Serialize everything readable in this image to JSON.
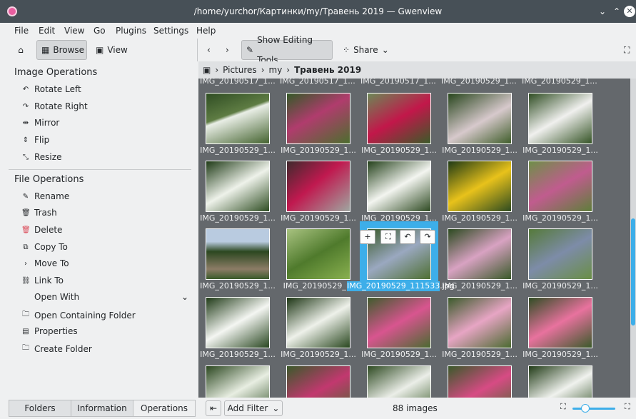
{
  "window": {
    "title": "/home/yurchor/Картинки/my/Травень 2019 — Gwenview"
  },
  "menu": [
    "File",
    "Edit",
    "View",
    "Go",
    "Plugins",
    "Settings",
    "Help"
  ],
  "toolbar": {
    "browse": "Browse",
    "view": "View",
    "show_editing_tools": "Show Editing Tools",
    "share": "Share"
  },
  "sidebar": {
    "image_ops_title": "Image Operations",
    "image_ops": [
      "Rotate Left",
      "Rotate Right",
      "Mirror",
      "Flip",
      "Resize"
    ],
    "file_ops_title": "File Operations",
    "file_ops": [
      "Rename",
      "Trash",
      "Delete",
      "Copy To",
      "Move To",
      "Link To"
    ],
    "open_with": "Open With",
    "more_ops": [
      "Open Containing Folder",
      "Properties",
      "Create Folder"
    ],
    "tabs": [
      "Folders",
      "Information",
      "Operations"
    ]
  },
  "breadcrumb": [
    "Pictures",
    "my",
    "Травень 2019"
  ],
  "thumbnails": {
    "top_row_labels": [
      "IMG_20190517_1...",
      "IMG_20190517_1...",
      "IMG_20190517_1...",
      "IMG_20190529_1...",
      "IMG_20190529_1..."
    ],
    "label": "IMG_20190529_1...",
    "row3_col2_label": "IMG_20190529_1.",
    "selected_label": "IMG_20190529_111533.jpg"
  },
  "statusbar": {
    "add_filter": "Add Filter",
    "count": "88 images"
  }
}
